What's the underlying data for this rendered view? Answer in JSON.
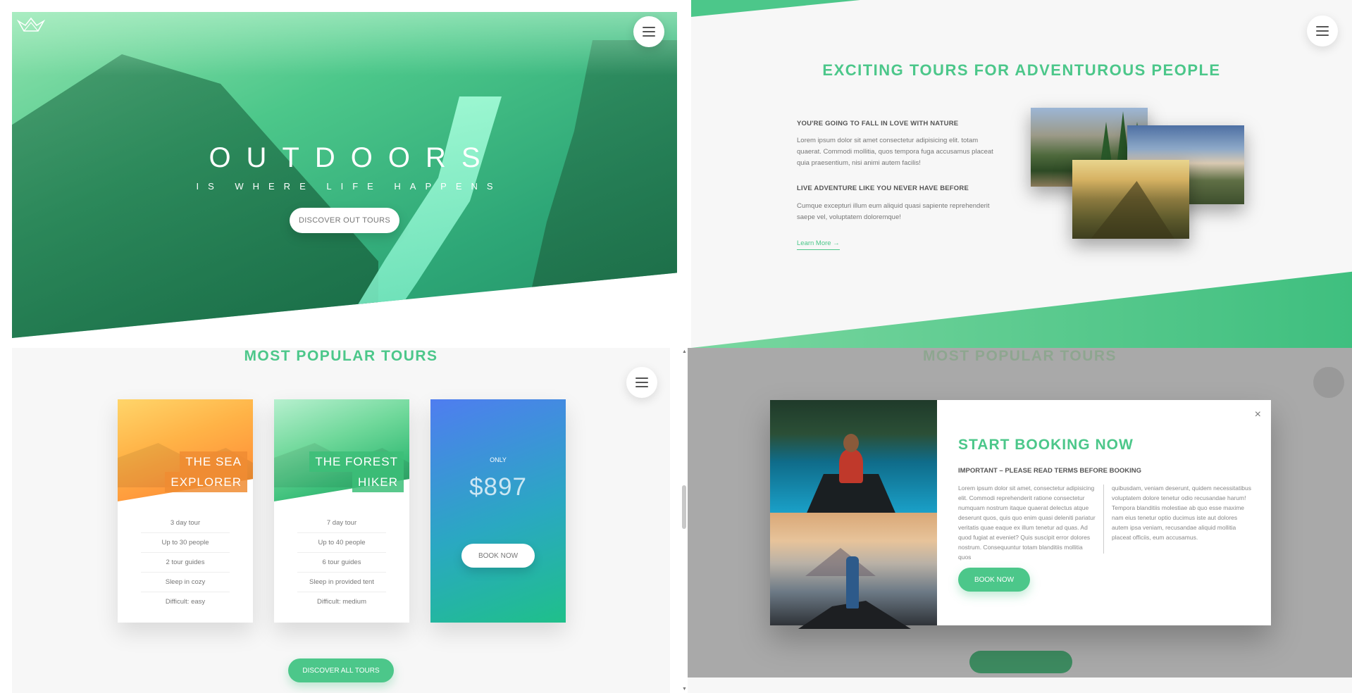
{
  "hero": {
    "title": "OUTDOORS",
    "subtitle": "IS WHERE LIFE HAPPENS",
    "cta_label": "DISCOVER OUT TOURS",
    "logo_icon": "crown-icon",
    "menu_icon": "hamburger-icon"
  },
  "about": {
    "title": "EXCITING TOURS FOR ADVENTUROUS PEOPLE",
    "heading1": "YOU'RE GOING TO FALL IN LOVE WITH NATURE",
    "para1": "Lorem ipsum dolor sit amet consectetur adipisicing elit. totam quaerat. Commodi mollitia, quos tempora fuga accusamus placeat quia praesentium, nisi animi autem facilis!",
    "heading2": "LIVE ADVENTURE LIKE YOU NEVER HAVE BEFORE",
    "para2": "Cumque excepturi illum eum aliquid quasi sapiente reprehenderit saepe vel, voluptatem doloremque!",
    "learn_more": "Learn More →"
  },
  "tours": {
    "title": "MOST POPULAR TOURS",
    "cards": [
      {
        "title_line1": "THE SEA",
        "title_line2": "EXPLORER",
        "details": [
          "3 day tour",
          "Up to 30 people",
          "2 tour guides",
          "Sleep in cozy",
          "Difficult: easy"
        ]
      },
      {
        "title_line1": "THE FOREST",
        "title_line2": "HIKER",
        "details": [
          "7 day tour",
          "Up to 40 people",
          "6 tour guides",
          "Sleep in provided tent",
          "Difficult: medium"
        ]
      }
    ],
    "price_card": {
      "only": "ONLY",
      "price": "$897",
      "book_label": "BOOK NOW"
    },
    "discover_all": "DISCOVER ALL TOURS"
  },
  "modal": {
    "close": "×",
    "title": "START BOOKING NOW",
    "subtitle": "IMPORTANT – PLEASE READ TERMS BEFORE BOOKING",
    "col1": "Lorem ipsum dolor sit amet, consectetur adipisicing elit. Commodi reprehenderit ratione consectetur numquam nostrum itaque quaerat delectus atque deserunt quos, quis quo enim quasi deleniti pariatur veritatis quae eaque ex illum tenetur ad quas. Ad quod fugiat at eveniet? Quis suscipit error dolores nostrum. Consequuntur totam blanditiis mollitia quos",
    "col2": "quibusdam, veniam deserunt, quidem necessitatibus voluptatem dolore tenetur odio recusandae harum! Tempora blanditiis molestiae ab quo esse maxime nam eius tenetur optio ducimus iste aut dolores autem ipsa veniam, recusandae aliquid mollitia placeat officiis, eum accusamus.",
    "book_label": "BOOK NOW"
  },
  "colors": {
    "accent": "#4cc78a",
    "sea": "#ff9a3c",
    "price_gradient_start": "#4f7df0",
    "price_gradient_end": "#1fc08a"
  }
}
